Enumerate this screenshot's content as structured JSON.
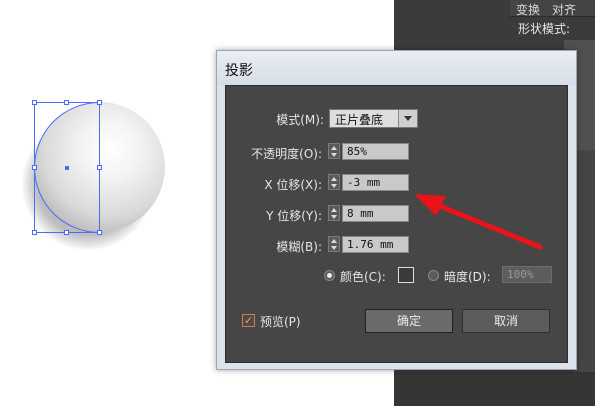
{
  "panel": {
    "tabs": [
      "变换",
      "对齐"
    ],
    "shape_mode_label": "形状模式:"
  },
  "dialog": {
    "title": "投影",
    "mode": {
      "label": "模式(M):",
      "value": "正片叠底"
    },
    "opacity": {
      "label": "不透明度(O):",
      "value": "85%"
    },
    "x_offset": {
      "label": "X 位移(X):",
      "value": "-3 mm"
    },
    "y_offset": {
      "label": "Y 位移(Y):",
      "value": "8 mm"
    },
    "blur": {
      "label": "模糊(B):",
      "value": "1.76 mm"
    },
    "color_option": {
      "label": "颜色(C):",
      "selected": true,
      "swatch_color": "#3a3a3a"
    },
    "darkness_option": {
      "label": "暗度(D):",
      "value": "100%",
      "selected": false
    },
    "preview": {
      "label": "预览(P)",
      "checked": true,
      "check_glyph": "✓"
    },
    "ok_label": "确定",
    "cancel_label": "取消"
  },
  "colors": {
    "selection": "#4a6cf7",
    "annotation_arrow": "#e8141a"
  }
}
